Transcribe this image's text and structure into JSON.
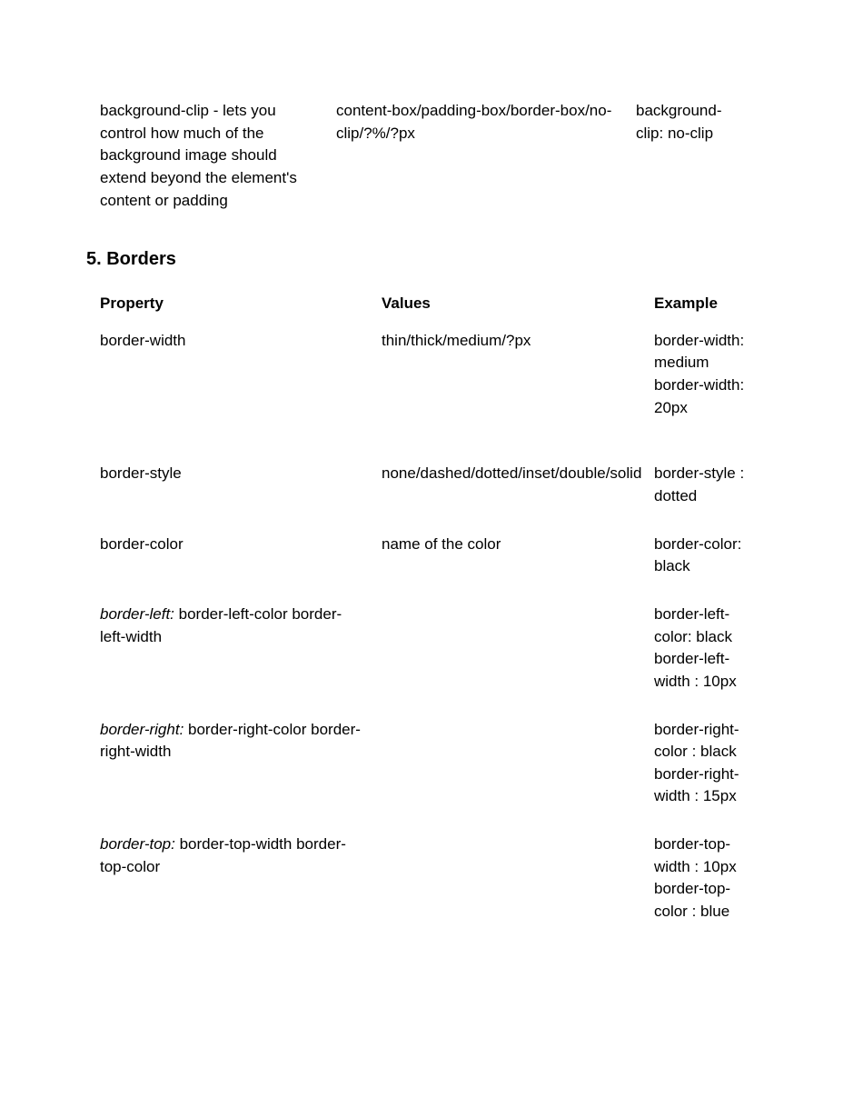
{
  "topRow": {
    "property": "background-clip - lets you control how much of the background image should extend beyond the element's content or padding",
    "values": "content-box/padding-box/border-box/no-clip/?%/?px",
    "example": "background-clip: no-clip"
  },
  "sectionTitle": "5. Borders",
  "headers": {
    "property": "Property",
    "values": "Values",
    "example": "Example"
  },
  "rows": [
    {
      "propertyItalic": "",
      "propertyRest": "border-width",
      "values": "thin/thick/medium/?px",
      "example": "border-width: medium border-width: 20px",
      "extra": true
    },
    {
      "propertyItalic": "",
      "propertyRest": "border-style",
      "values": "none/dashed/dotted/inset/double/solid",
      "example": "border-style : dotted",
      "extra": false
    },
    {
      "propertyItalic": "",
      "propertyRest": "border-color",
      "values": "name of the color",
      "example": "border-color: black",
      "extra": false
    },
    {
      "propertyItalic": "border-left:",
      "propertyRest": " border-left-color border-left-width",
      "values": "",
      "example": "border-left-color: black border-left-width : 10px",
      "extra": false
    },
    {
      "propertyItalic": "border-right:",
      "propertyRest": " border-right-color border-right-width",
      "values": "",
      "example": "border-right-color : black border-right-width : 15px",
      "extra": false
    },
    {
      "propertyItalic": "border-top:",
      "propertyRest": " border-top-width border-top-color",
      "values": "",
      "example": "border-top-width : 10px border-top-color : blue",
      "extra": false
    }
  ]
}
